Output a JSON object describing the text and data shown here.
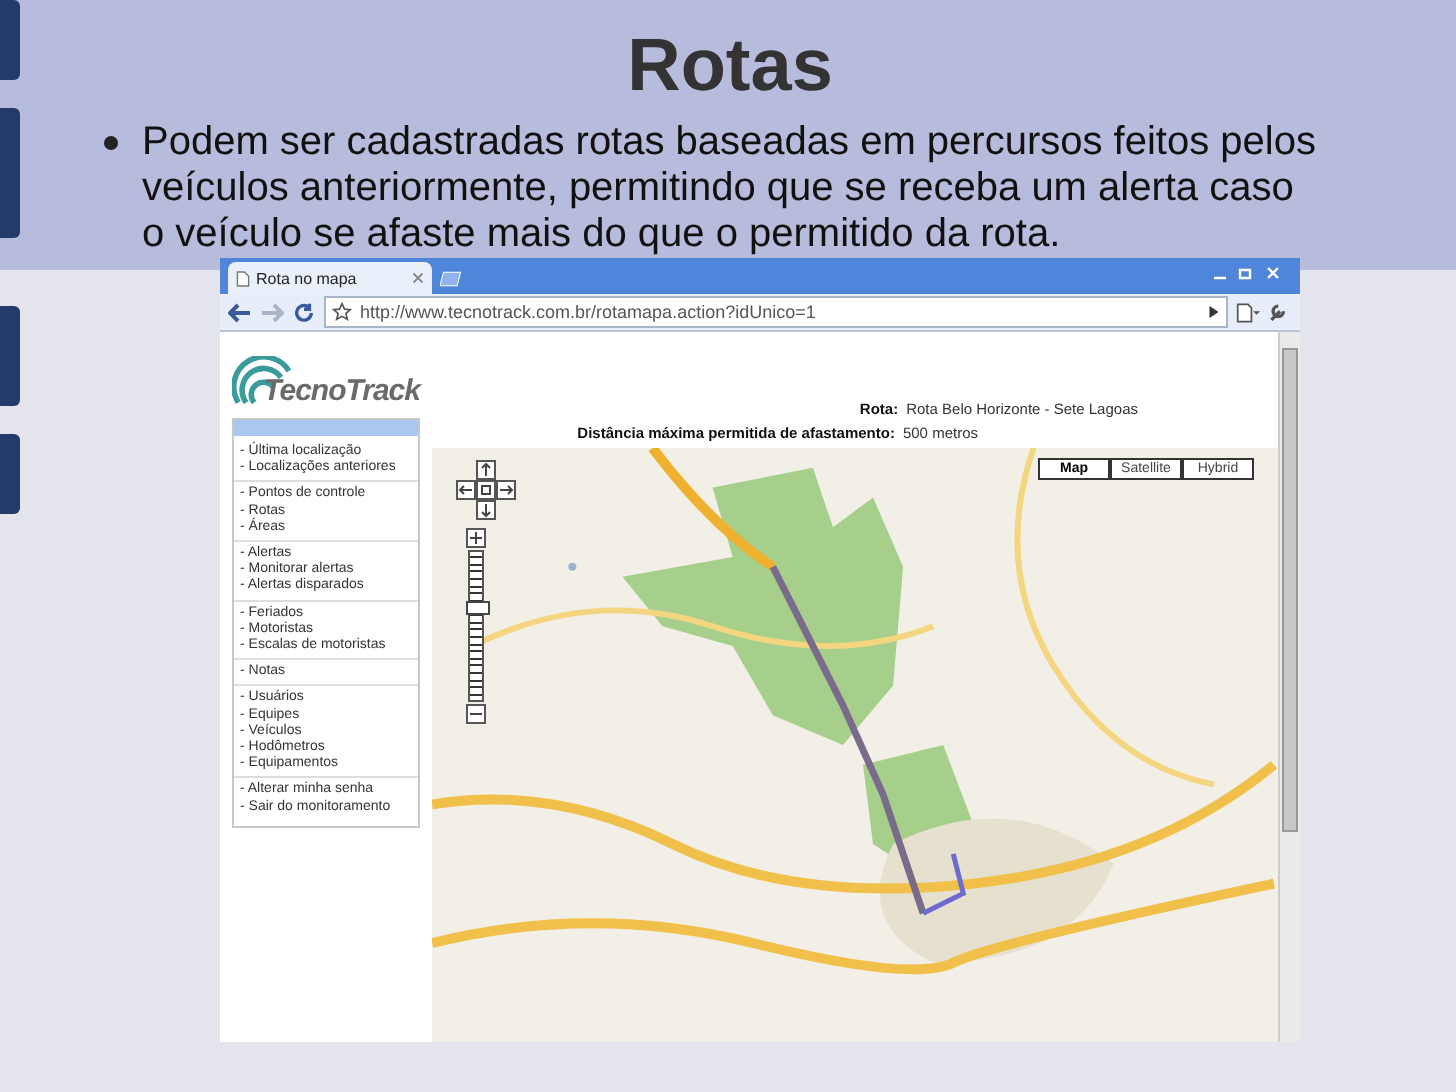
{
  "slide": {
    "title": "Rotas",
    "bullets": [
      "Podem ser cadastradas rotas baseadas em percursos feitos pelos veículos anteriormente, permitindo que se receba um alerta caso o veículo se afaste mais do que o permitido da rota."
    ]
  },
  "browser": {
    "tab_title": "Rota no mapa",
    "url": "http://www.tecnotrack.com.br/rotamapa.action?idUnico=1"
  },
  "page": {
    "logo": "TecnoTrack",
    "menu_groups": [
      [
        "- Última localização",
        "- Localizações anteriores"
      ],
      [
        "- Pontos de controle",
        "- Rotas",
        "- Áreas"
      ],
      [
        "- Alertas",
        "- Monitorar alertas",
        "- Alertas disparados"
      ],
      [
        "- Feriados",
        "- Motoristas",
        "- Escalas de motoristas"
      ],
      [
        "- Notas"
      ],
      [
        "- Usuários",
        "- Equipes",
        "- Veículos",
        "- Hodômetros",
        "- Equipamentos"
      ],
      [
        "- Alterar minha senha",
        "- Sair do monitoramento"
      ]
    ],
    "route_label": "Rota:",
    "route_value": "Rota Belo Horizonte - Sete Lagoas",
    "distance_label": "Distância máxima permitida de afastamento:",
    "distance_value": "500 metros",
    "map": {
      "level": 0.62,
      "types": [
        {
          "label": "Map",
          "selected": true
        },
        {
          "label": "Satellite",
          "selected": false
        },
        {
          "label": "Hybrid",
          "selected": false
        }
      ]
    }
  }
}
